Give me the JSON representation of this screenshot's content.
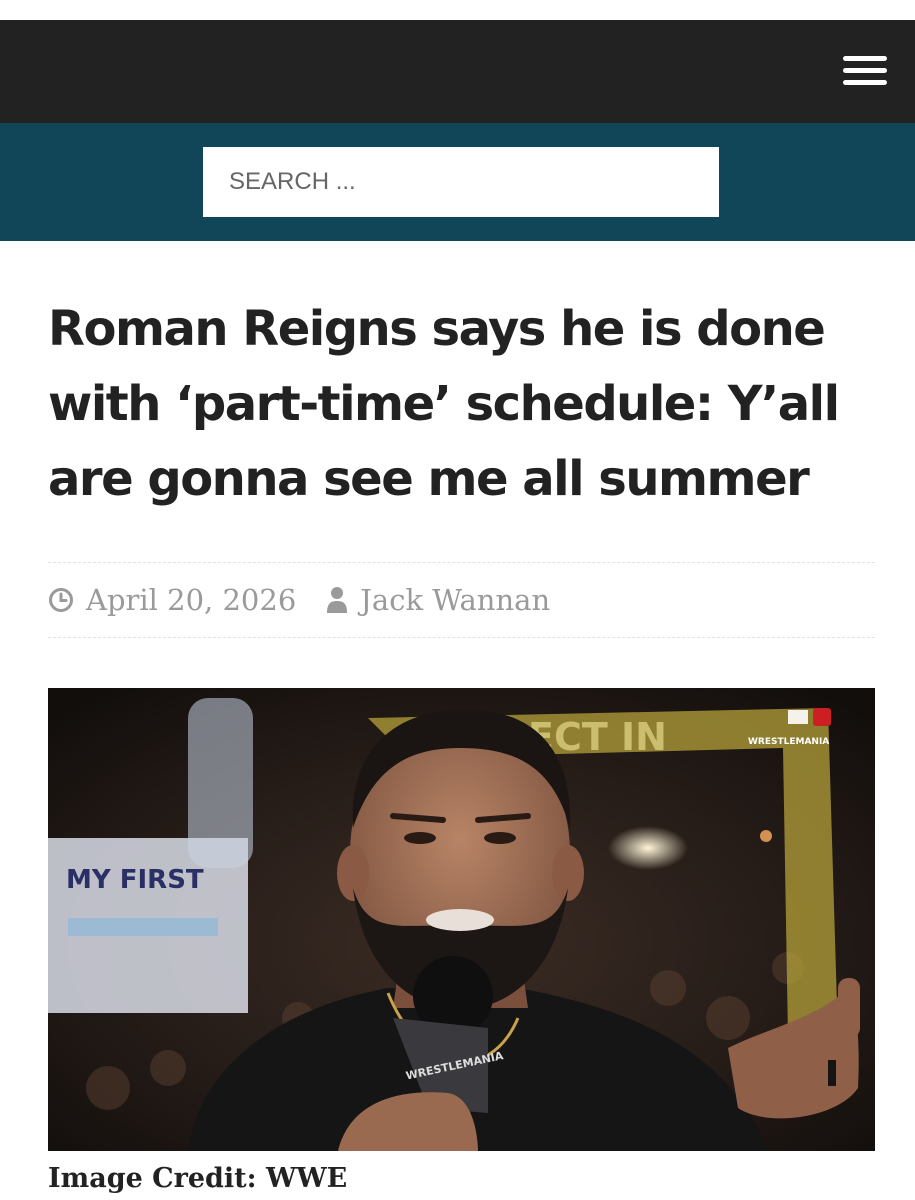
{
  "header": {
    "menu_icon": "hamburger-menu-icon"
  },
  "search": {
    "placeholder": "SEARCH ..."
  },
  "article": {
    "title": "Roman Reigns says he is done with ‘part-time’ schedule: Y’all are gonna see me all summer",
    "date": "April 20, 2026",
    "author": "Jack Wannan",
    "date_icon": "clock-icon",
    "author_icon": "user-icon",
    "image_credit": "Image Credit: WWE",
    "image": {
      "sign_text": "MY FIRST",
      "arch_text": "ECT IN",
      "logo_text": "WRESTLEMANIA",
      "mic_text": "WRESTLEMANIA"
    }
  },
  "colors": {
    "topbar": "#222222",
    "searchbar": "#114558",
    "title": "#222222",
    "meta": "#9a9a9a"
  }
}
